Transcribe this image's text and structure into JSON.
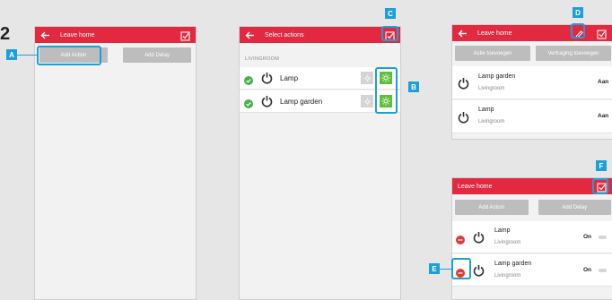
{
  "step_number": "2",
  "screen1": {
    "title": "Leave home",
    "add_action": "Add Action",
    "add_delay": "Add Delay"
  },
  "screen2": {
    "title": "Select actions",
    "section": "LIVINGROOM",
    "items": [
      {
        "label": "Lamp"
      },
      {
        "label": "Lamp garden"
      }
    ]
  },
  "screen3": {
    "title": "Leave home",
    "add_action": "Actie toevoegen",
    "add_delay": "Vertraging toevoegen",
    "items": [
      {
        "label": "Lamp garden",
        "room": "Livingroom",
        "state": "Aan"
      },
      {
        "label": "Lamp",
        "room": "Livingroom",
        "state": "Aan"
      }
    ]
  },
  "screen4": {
    "title": "Leave home",
    "add_action": "Add Action",
    "add_delay": "Add Delay",
    "items": [
      {
        "label": "Lamp",
        "room": "Livingroom",
        "state": "On"
      },
      {
        "label": "Lamp garden",
        "room": "Livingroom",
        "state": "On"
      }
    ]
  },
  "callouts": {
    "a": "A",
    "b": "B",
    "c": "C",
    "d": "D",
    "e": "E",
    "f": "F"
  },
  "colors": {
    "brand_red": "#e3293f",
    "callout_blue": "#1e9fd8",
    "success_green": "#4caf50",
    "delete_red": "#e53935",
    "button_gray": "#bdbdbd"
  }
}
